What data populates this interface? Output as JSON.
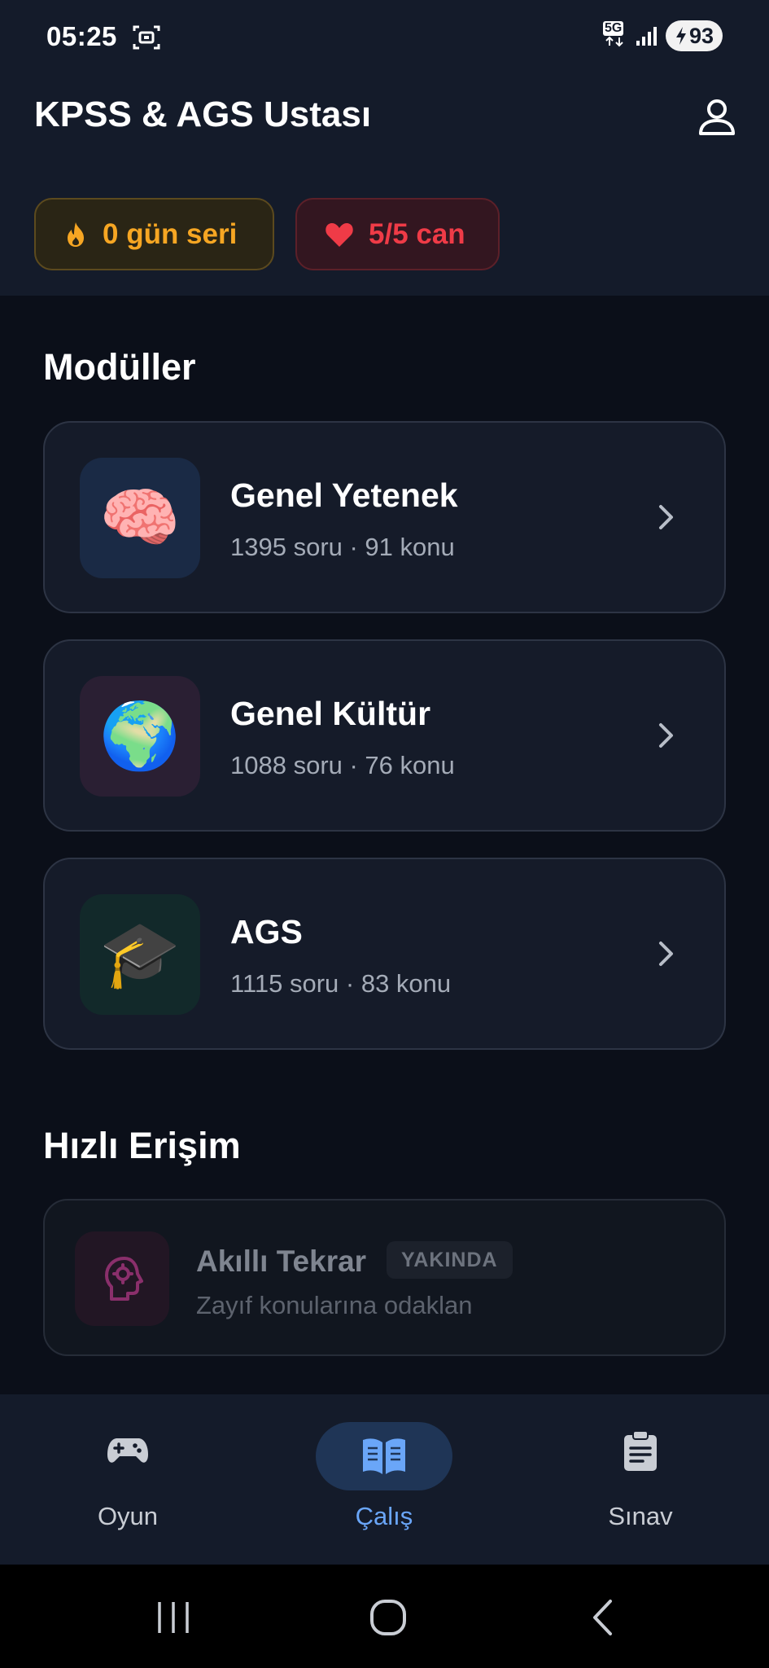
{
  "status_bar": {
    "time": "05:25",
    "network": "5G",
    "battery": "93"
  },
  "header": {
    "title": "KPSS & AGS Ustası",
    "streak_label": "0 gün seri",
    "lives_label": "5/5 can"
  },
  "modules": {
    "section_title": "Modüller",
    "items": [
      {
        "name": "Genel Yetenek",
        "meta": "1395 soru · 91 konu",
        "icon": "brain-icon",
        "icon_emoji": "🧠",
        "tint": "#1a2a45"
      },
      {
        "name": "Genel Kültür",
        "meta": "1088 soru · 76 konu",
        "icon": "globe-icon",
        "icon_emoji": "🌍",
        "tint": "#2a1f33"
      },
      {
        "name": "AGS",
        "meta": "1115 soru · 83 konu",
        "icon": "graduation-cap-icon",
        "icon_emoji": "🎓",
        "tint": "#12292a"
      }
    ]
  },
  "quick_access": {
    "section_title": "Hızlı Erişim",
    "item": {
      "name": "Akıllı Tekrar",
      "badge": "YAKINDA",
      "subtitle": "Zayıf konularına odaklan",
      "icon": "head-gear-icon"
    }
  },
  "bottom_nav": {
    "items": [
      {
        "label": "Oyun",
        "icon": "gamepad-icon",
        "active": false
      },
      {
        "label": "Çalış",
        "icon": "book-open-icon",
        "active": true
      },
      {
        "label": "Sınav",
        "icon": "clipboard-icon",
        "active": false
      }
    ]
  },
  "colors": {
    "streak": "#f6a623",
    "lives": "#ef3b47",
    "active_nav": "#6aa6f8"
  }
}
